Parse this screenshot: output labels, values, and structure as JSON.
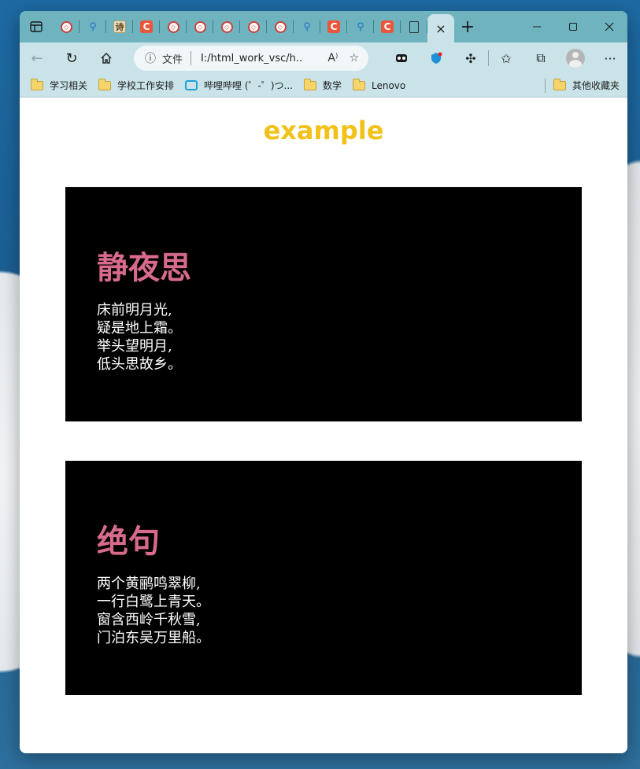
{
  "browser": {
    "tabs": [
      {
        "icon": "code-icon"
      },
      {
        "icon": "search-icon"
      },
      {
        "icon": "poem-icon",
        "text": "诗"
      },
      {
        "icon": "c-icon",
        "text": "C"
      },
      {
        "icon": "code-icon"
      },
      {
        "icon": "code-icon"
      },
      {
        "icon": "code-icon"
      },
      {
        "icon": "code-icon"
      },
      {
        "icon": "code-icon"
      },
      {
        "icon": "search-icon"
      },
      {
        "icon": "c-icon",
        "text": "C"
      },
      {
        "icon": "search-icon"
      },
      {
        "icon": "c-icon",
        "text": "C"
      },
      {
        "icon": "document-icon"
      }
    ],
    "active_tab_close": "×",
    "new_tab": "+",
    "address": {
      "prefix": "文件",
      "url": "I:/html_work_vsc/h..."
    },
    "bookmarks": [
      {
        "label": "学习相关",
        "icon": "folder-icon"
      },
      {
        "label": "学校工作安排",
        "icon": "folder-icon"
      },
      {
        "label": "哔哩哔哩 (゜-゜)つ...",
        "icon": "bilibili-icon"
      },
      {
        "label": "数学",
        "icon": "folder-icon"
      },
      {
        "label": "Lenovo",
        "icon": "folder-icon"
      }
    ],
    "other_bookmarks": "其他收藏夹"
  },
  "page": {
    "title": "example",
    "poems": [
      {
        "title": "静夜思",
        "lines": [
          "床前明月光,",
          "疑是地上霜。",
          "举头望明月,",
          "低头思故乡。"
        ]
      },
      {
        "title": "绝句",
        "lines": [
          "两个黄鹂鸣翠柳,",
          "一行白鹭上青天。",
          "窗含西岭千秋雪,",
          "门泊东吴万里船。"
        ]
      }
    ]
  },
  "colors": {
    "title": "#f2c21a",
    "poem_title": "#d86b8c",
    "card_bg": "#000000",
    "poem_text": "#ffffff"
  }
}
